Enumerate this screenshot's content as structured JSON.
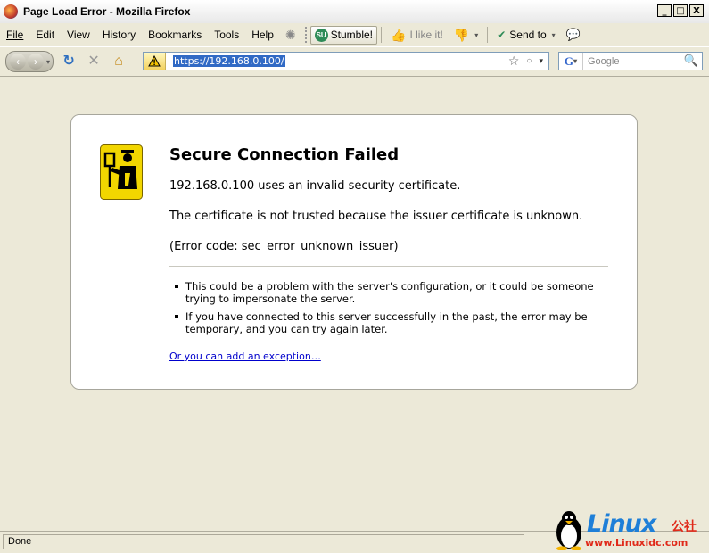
{
  "window": {
    "title": "Page Load Error - Mozilla Firefox",
    "buttons": [
      "_",
      "□",
      "X"
    ]
  },
  "menu": {
    "items": [
      "File",
      "Edit",
      "View",
      "History",
      "Bookmarks",
      "Tools",
      "Help"
    ],
    "underlined": [
      "F",
      "E",
      "V",
      "H",
      "B",
      "T",
      "H"
    ]
  },
  "toolbar": {
    "stumble_label": "Stumble!",
    "like_label": "I like it!",
    "sendto_label": "Send to"
  },
  "navigation": {
    "url": "https://192.168.0.100/",
    "search_placeholder": "Google"
  },
  "error": {
    "title": "Secure Connection Failed",
    "line1": "192.168.0.100 uses an invalid security certificate.",
    "line2": "The certificate is not trusted because the issuer certificate is unknown.",
    "line3": "(Error code: sec_error_unknown_issuer)",
    "bullets": [
      "This could be a problem with the server's configuration, or it could be someone trying to impersonate the server.",
      "If you have connected to this server successfully in the past, the error may be temporary, and you can try again later."
    ],
    "exception_link": "Or you can add an exception…"
  },
  "status": {
    "text": "Done"
  },
  "watermark": {
    "brand": "Linux",
    "cn": "公社",
    "url": "www.Linuxidc.com"
  },
  "colors": {
    "link": "#0000cc",
    "url_highlight": "#316ac5",
    "watermark_blue": "#1e7fd8",
    "watermark_red": "#e02a1a"
  }
}
